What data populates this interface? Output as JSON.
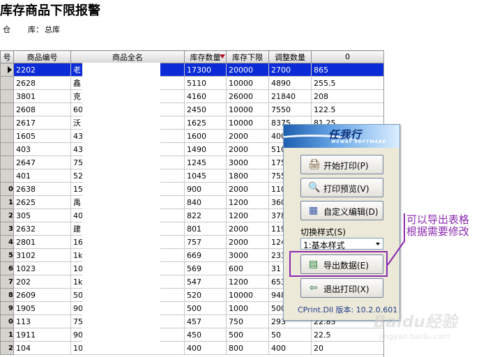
{
  "title": "库存商品下限报警",
  "warehouse": {
    "prefix": "仓",
    "label": "库：",
    "value": "总库"
  },
  "grid": {
    "headers": [
      "号",
      "商品编号",
      "商品全名",
      "库存数量",
      "库存下限",
      "调整数量",
      "0"
    ],
    "rows": [
      {
        "no": "",
        "code": "2202",
        "name": "老",
        "qty": "17300",
        "min": "20000",
        "adj": "2700",
        "last": "865"
      },
      {
        "no": "",
        "code": "2628",
        "name": "鑫",
        "qty": "5110",
        "min": "10000",
        "adj": "4890",
        "last": "255.5"
      },
      {
        "no": "",
        "code": "3801",
        "name": "克",
        "qty": "4160",
        "min": "26000",
        "adj": "21840",
        "last": "208"
      },
      {
        "no": "",
        "code": "2608",
        "name": "60",
        "qty": "2450",
        "min": "10000",
        "adj": "7550",
        "last": "122.5"
      },
      {
        "no": "",
        "code": "2617",
        "name": "沃",
        "qty": "1625",
        "min": "10000",
        "adj": "8375",
        "last": "81.25"
      },
      {
        "no": "",
        "code": "1605",
        "name": "43",
        "qty": "1600",
        "min": "2000",
        "adj": "400",
        "last": ""
      },
      {
        "no": "",
        "code": "403",
        "name": "43",
        "qty": "1490",
        "min": "2000",
        "adj": "510",
        "last": ""
      },
      {
        "no": "",
        "code": "2647",
        "name": "75",
        "qty": "1245",
        "min": "3000",
        "adj": "175",
        "last": ""
      },
      {
        "no": "",
        "code": "401",
        "name": "52",
        "qty": "1045",
        "min": "1800",
        "adj": "755",
        "last": ""
      },
      {
        "no": "0",
        "code": "2638",
        "name": "15",
        "qty": "900",
        "min": "2000",
        "adj": "110",
        "last": ""
      },
      {
        "no": "1",
        "code": "2625",
        "name": "禹",
        "qty": "840",
        "min": "1200",
        "adj": "360",
        "last": ""
      },
      {
        "no": "2",
        "code": "305",
        "name": "40",
        "qty": "822",
        "min": "1200",
        "adj": "378",
        "last": ""
      },
      {
        "no": "3",
        "code": "2632",
        "name": "建",
        "qty": "801",
        "min": "2000",
        "adj": "119",
        "last": ""
      },
      {
        "no": "4",
        "code": "2801",
        "name": "16",
        "qty": "757",
        "min": "2000",
        "adj": "124",
        "last": ""
      },
      {
        "no": "5",
        "code": "3102",
        "name": "1k",
        "qty": "669",
        "min": "3000",
        "adj": "233",
        "last": ""
      },
      {
        "no": "6",
        "code": "1023",
        "name": "10",
        "qty": "569",
        "min": "600",
        "adj": "31",
        "last": ""
      },
      {
        "no": "7",
        "code": "202",
        "name": "1k",
        "qty": "547",
        "min": "1200",
        "adj": "653",
        "last": ""
      },
      {
        "no": "8",
        "code": "2609",
        "name": "50",
        "qty": "520",
        "min": "10000",
        "adj": "948",
        "last": ""
      },
      {
        "no": "9",
        "code": "1905",
        "name": "90",
        "qty": "500",
        "min": "1000",
        "adj": "500",
        "last": ""
      },
      {
        "no": "0",
        "code": "113",
        "name": "75",
        "qty": "457",
        "min": "750",
        "adj": "293",
        "last": "22.85"
      },
      {
        "no": "1",
        "code": "1911",
        "name": "90",
        "qty": "450",
        "min": "500",
        "adj": "50",
        "last": "22.5"
      },
      {
        "no": "2",
        "code": "104",
        "name": "10",
        "qty": "400",
        "min": "800",
        "adj": "400",
        "last": "20"
      }
    ]
  },
  "print_panel": {
    "logo": "任我行",
    "logo_sub": "WEWAY SOFTWARE",
    "buttons": [
      {
        "label": "开始打印(P)",
        "icon": "printer-icon",
        "glyph": "🖨"
      },
      {
        "label": "打印预览(V)",
        "icon": "preview-icon",
        "glyph": "🔍"
      },
      {
        "label": "自定义编辑(D)",
        "icon": "edit-icon",
        "glyph": "▦"
      },
      {
        "label": "导出数据(E)",
        "icon": "excel-icon",
        "glyph": "▤"
      },
      {
        "label": "退出打印(X)",
        "icon": "exit-icon",
        "glyph": "⇦"
      }
    ],
    "style_label": "切换样式(S)",
    "style_value": "1:基本样式",
    "version": "CPrint.Dll 版本: 10.2.0.601"
  },
  "annotation": {
    "line1": "可以导出表格",
    "line2": "根据需要修改"
  },
  "watermark": {
    "text1": "Baidu经验",
    "text2": "jingyan.baidu.com"
  },
  "colors": {
    "selection": "#0a2bd6",
    "annotation": "#8a2ab0"
  }
}
